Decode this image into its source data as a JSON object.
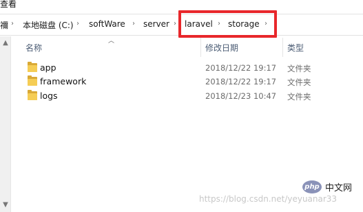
{
  "menu": {
    "view_label": "查看"
  },
  "address_bar": {
    "crumbs": [
      "禰",
      "本地磁盘 (C:)",
      "softWare",
      "server",
      "laravel",
      "storage"
    ],
    "separator": "›"
  },
  "columns": {
    "name": "名称",
    "modified": "修改日期",
    "type": "类型"
  },
  "files": [
    {
      "name": "app",
      "modified": "2018/12/22 19:17",
      "type": "文件夹",
      "icon": "folder-icon"
    },
    {
      "name": "framework",
      "modified": "2018/12/22 19:17",
      "type": "文件夹",
      "icon": "folder-icon"
    },
    {
      "name": "logs",
      "modified": "2018/12/23 10:47",
      "type": "文件夹",
      "icon": "folder-icon"
    }
  ],
  "watermark": {
    "logo_text": "php",
    "site_cn": "中文网",
    "url": "https://blog.csdn.net/yeyuanar33"
  },
  "colors": {
    "highlight": "#e8272b",
    "folder": "#f5cd55",
    "header_text": "#4a5b73"
  }
}
